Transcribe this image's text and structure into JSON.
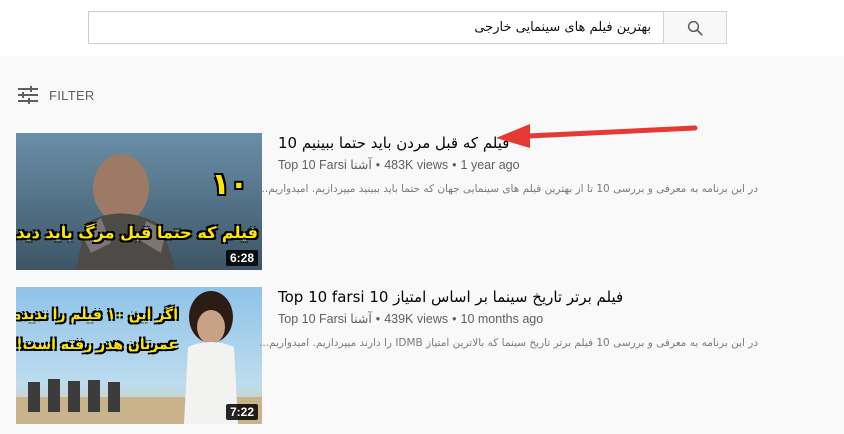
{
  "search": {
    "query": "بهترین فیلم های سینمایی خارجی"
  },
  "filter": {
    "label": "FILTER"
  },
  "results": [
    {
      "title": "فیلم که قبل مردن باید حتما ببینیم 10",
      "channel": "Top 10 Farsi آشنا",
      "views": "483K views",
      "age": "1 year ago",
      "description": "در این برنامه به معرفی و بررسی 10 تا از بهترین فیلم های سینمایی جهان که حتما باید ببینید میپردازیم. امیدواریم...",
      "duration": "6:28",
      "thumb_caption_top": "۱۰",
      "thumb_caption_bottom": "فیلم که حتما قبل مرگ باید دید"
    },
    {
      "title": "Top 10 farsi فیلم برتر تاریخ سینما بر اساس امتیاز 10",
      "channel": "Top 10 Farsi آشنا",
      "views": "439K views",
      "age": "10 months ago",
      "description": "در این برنامه به معرفی و بررسی 10 فیلم برتر تاریخ سینما که بالاترین امتیاز IDMB را دارند میپردازیم. امیدواریم...",
      "duration": "7:22",
      "thumb_caption_top": "اگر این ۱۰ فیلم را ندیده اید",
      "thumb_caption_bottom": "عمرتان هدر رفته است!"
    }
  ],
  "colors": {
    "accent_arrow": "#e53935",
    "thumb_text_yellow": "#ffe600"
  }
}
